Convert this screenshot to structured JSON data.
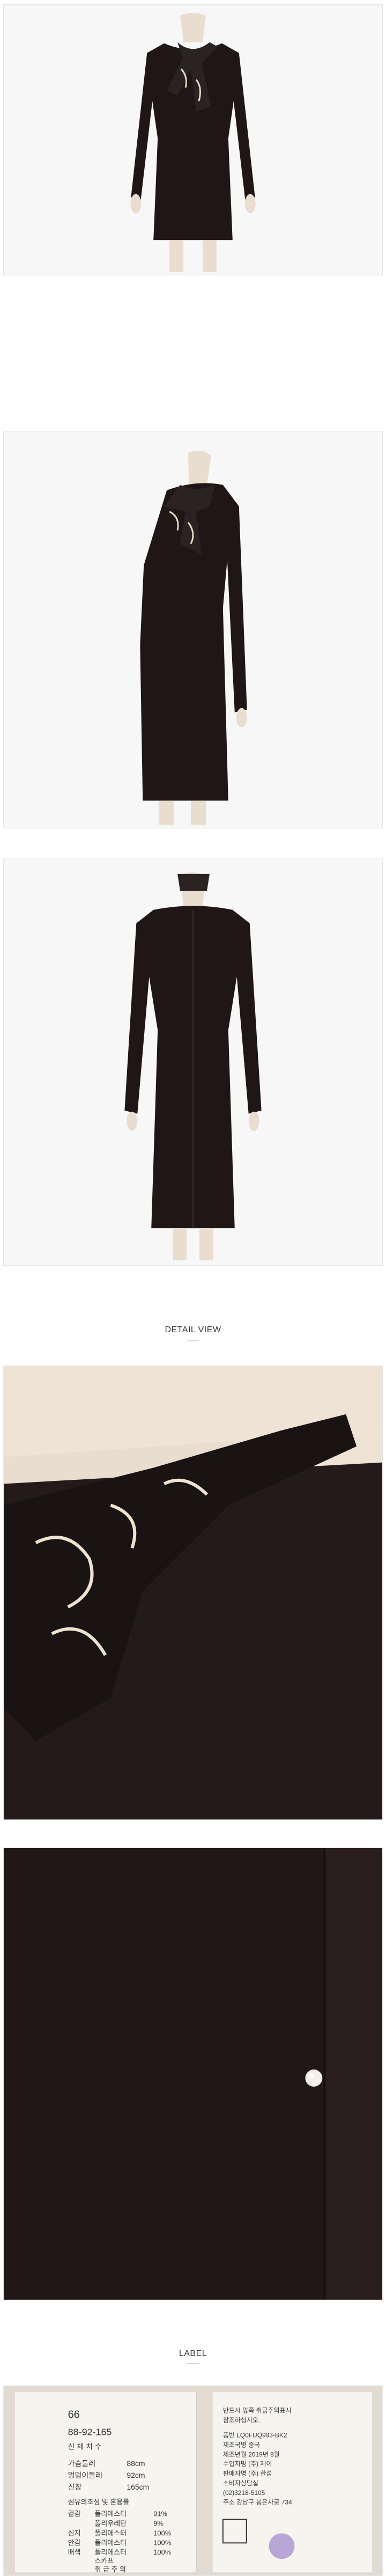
{
  "sections": {
    "detail_title": "DETAIL VIEW",
    "label_title": "LABEL"
  },
  "label_left": {
    "size": "66",
    "size_code": "88-92-165",
    "size_caption": "신 체 치 수",
    "rows": [
      [
        "가슴둘레",
        "88cm"
      ],
      [
        "엉덩이둘레",
        "92cm"
      ],
      [
        "신장",
        "165cm"
      ]
    ],
    "fabric_caption": "섬유의조성 및 혼용률",
    "fabric": [
      [
        "겉감",
        "폴리에스터",
        "91%"
      ],
      [
        "",
        "폴리우레탄",
        "9%"
      ],
      [
        "심지",
        "폴리에스터",
        "100%"
      ],
      [
        "안감",
        "폴리에스터",
        "100%"
      ],
      [
        "배색",
        "폴리에스터",
        "100%"
      ],
      [
        "",
        "스카프",
        ""
      ]
    ],
    "care_caption": "취 급 주 의"
  },
  "label_right": {
    "lines": [
      "반드시 앞쪽 취급주의표시",
      "참조하십시오.",
      "품번 LQ0FUQ993-BK2",
      "제조국명 중국",
      "제조년월 2019년 8월",
      "수입자명 (주) 제이",
      "판매자명 (주) 한섬",
      "소비자상담실",
      "(02)3218-5105",
      "주소 강남구 봉은사로 734"
    ]
  }
}
